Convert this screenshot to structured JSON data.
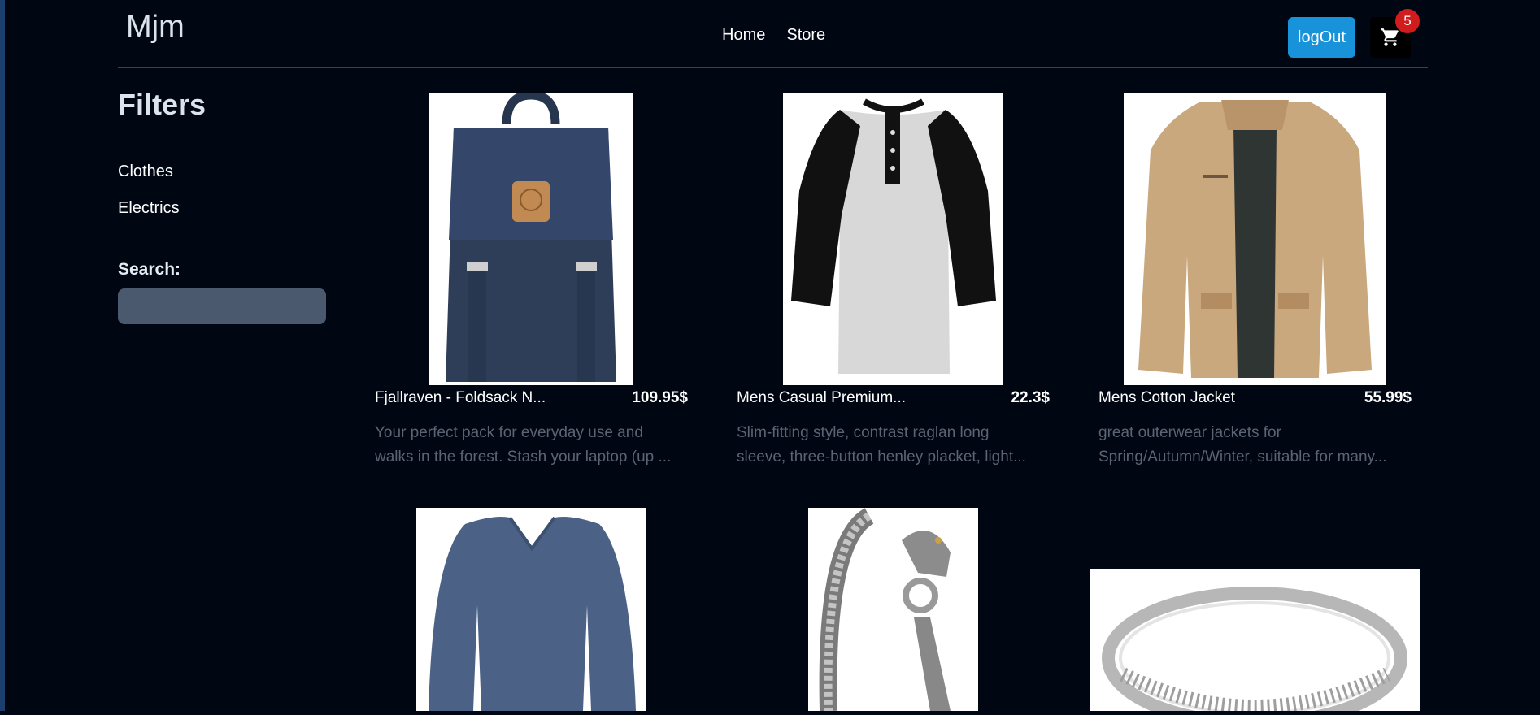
{
  "brand": "Mjm",
  "nav": {
    "home": "Home",
    "store": "Store"
  },
  "header": {
    "logout_label": "logOut",
    "cart_count": "5"
  },
  "filters": {
    "title": "Filters",
    "categories": [
      "Clothes",
      "Electrics"
    ],
    "search_label": "Search:",
    "search_value": ""
  },
  "products": [
    {
      "title": "Fjallraven - Foldsack N...",
      "price": "109.95$",
      "desc_line1": "Your perfect pack for everyday use and",
      "desc_line2": "walks in the forest. Stash your laptop (up ..."
    },
    {
      "title": "Mens Casual Premium...",
      "price": "22.3$",
      "desc_line1": "Slim-fitting style, contrast raglan long",
      "desc_line2": "sleeve, three-button henley placket, light..."
    },
    {
      "title": "Mens Cotton Jacket",
      "price": "55.99$",
      "desc_line1": "great outerwear jackets for",
      "desc_line2": "Spring/Autumn/Winter, suitable for many..."
    }
  ],
  "colors": {
    "background": "#010613",
    "accent": "#1892d8",
    "badge": "#d01c1c",
    "muted_text": "#5b6472",
    "search_bg": "#4b596e"
  }
}
